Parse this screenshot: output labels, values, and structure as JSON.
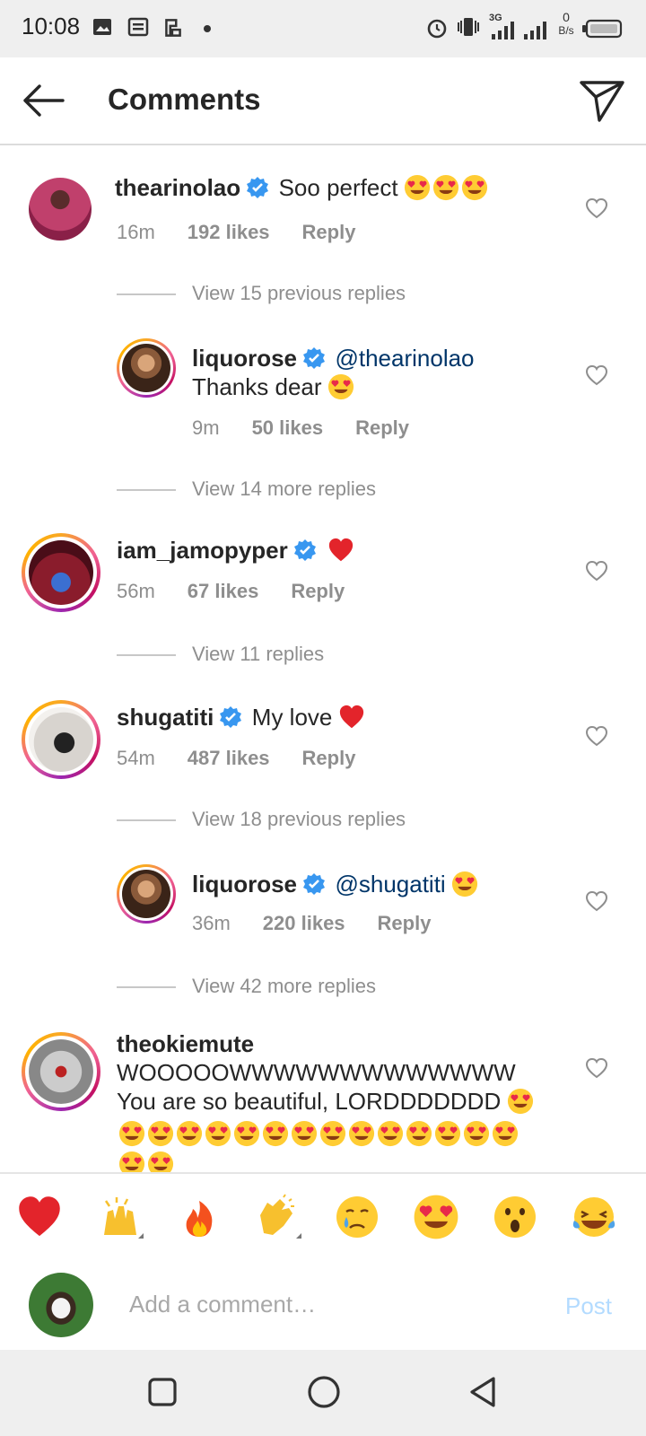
{
  "status_bar": {
    "time": "10:08",
    "net_speed": "0",
    "net_unit": "B/s",
    "network": "3G",
    "icons": [
      "image-icon",
      "news-icon",
      "sync-icon",
      "dot-icon",
      "alarm-icon",
      "vibrate-icon",
      "signal-icon",
      "signal-icon",
      "battery-icon"
    ]
  },
  "header": {
    "title": "Comments",
    "back_icon": "arrow-left-icon",
    "share_icon": "send-icon"
  },
  "comments": [
    {
      "username": "thearinolao",
      "verified": true,
      "text": "Soo perfect",
      "emoji": [
        "heart-eyes",
        "heart-eyes",
        "heart-eyes"
      ],
      "time": "16m",
      "likes": "192 likes",
      "reply": "Reply"
    },
    {
      "username": "liquorose",
      "verified": true,
      "mention": "@thearinolao",
      "text": "Thanks dear",
      "emoji": [
        "heart-eyes"
      ],
      "time": "9m",
      "likes": "50 likes",
      "reply": "Reply"
    },
    {
      "username": "iam_jamopyper",
      "verified": true,
      "text": "",
      "emoji": [
        "red-heart"
      ],
      "time": "56m",
      "likes": "67 likes",
      "reply": "Reply"
    },
    {
      "username": "shugatiti",
      "verified": true,
      "text": "My love",
      "emoji": [
        "red-heart"
      ],
      "time": "54m",
      "likes": "487 likes",
      "reply": "Reply"
    },
    {
      "username": "liquorose",
      "verified": true,
      "mention": "@shugatiti",
      "text": "",
      "emoji": [
        "heart-eyes"
      ],
      "time": "36m",
      "likes": "220 likes",
      "reply": "Reply"
    },
    {
      "username": "theokiemute",
      "verified": false,
      "text_line1": "WOOOOOWWWWWWWWWWWWW",
      "text_line2": "You are so beautiful, LORDDDDDDD",
      "emoji": [
        "heart-eyes"
      ]
    }
  ],
  "view_replies": [
    "View 15 previous replies",
    "View 14 more replies",
    "View 11 replies",
    "View 18 previous replies",
    "View 42 more replies"
  ],
  "reactions": [
    "red-heart",
    "raised-hands",
    "fire",
    "clapping-hands",
    "crying-face",
    "heart-eyes",
    "astonished-face",
    "tears-of-joy"
  ],
  "composer": {
    "placeholder": "Add a comment…",
    "post_label": "Post"
  },
  "nav_bar": [
    "square-icon",
    "circle-icon",
    "triangle-back-icon"
  ]
}
